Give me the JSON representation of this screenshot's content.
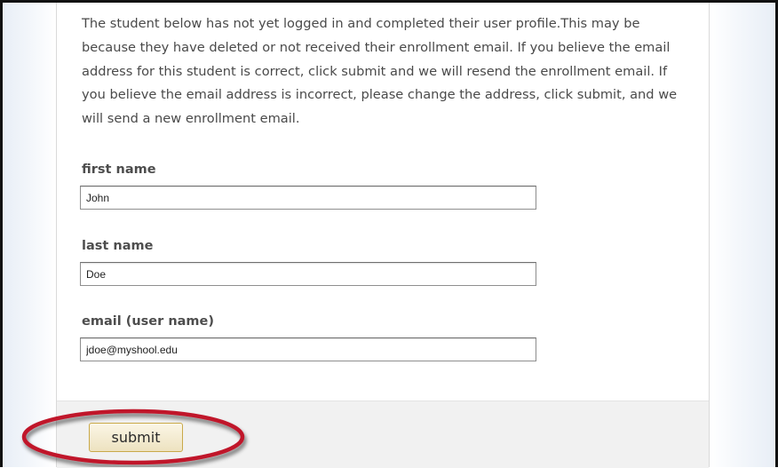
{
  "form": {
    "intro": "The student below has not yet logged in and completed their user profile.This may be because they have deleted or not received their enrollment email. If you believe the email address for this student is correct, click submit and we will resend the enrollment email. If you believe the email address is incorrect, please change the address, click submit, and we will send a new enrollment email.",
    "first_name_label": "first name",
    "first_name_value": "John",
    "last_name_label": "last name",
    "last_name_value": "Doe",
    "email_label": "email (user name)",
    "email_value": "jdoe@myshool.edu",
    "submit_label": "submit"
  },
  "annotation": {
    "highlight_color": "#c0162c",
    "highlights": "submit-button"
  }
}
